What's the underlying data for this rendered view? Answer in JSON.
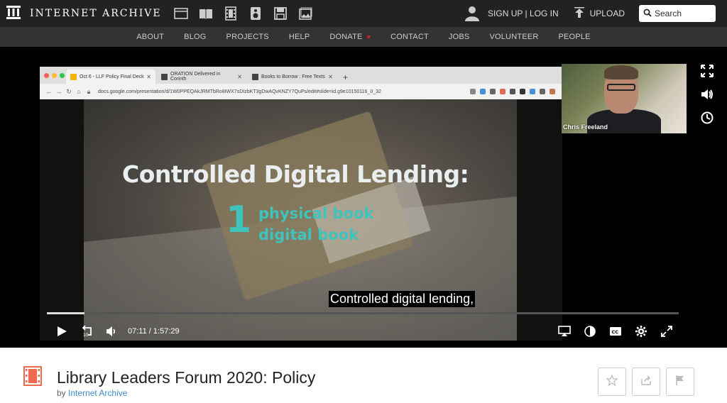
{
  "header": {
    "logo_text": "INTERNET ARCHIVE",
    "media_icons": [
      "web-icon",
      "texts-icon",
      "video-icon",
      "audio-icon",
      "software-icon",
      "images-icon"
    ],
    "signup_text": "SIGN UP | LOG IN",
    "upload_text": "UPLOAD",
    "search_placeholder": "Search"
  },
  "nav": {
    "items": [
      "ABOUT",
      "BLOG",
      "PROJECTS",
      "HELP",
      "DONATE",
      "CONTACT",
      "JOBS",
      "VOLUNTEER",
      "PEOPLE"
    ]
  },
  "browser": {
    "tabs": [
      {
        "label": "Oct 6 - LLF Policy Final Deck"
      },
      {
        "label": "ORATION Delivered in Corinth"
      },
      {
        "label": "Books to Borrow : Free Texts"
      }
    ],
    "url": "docs.google.com/presentation/d/1W0PPEQAkJRMTbRo8IWX7sDIzbKT3gDwAQvKNZY7QuPs/edit#slide=id.g9e10150116_0_32"
  },
  "slide": {
    "title": "Controlled Digital Lending:",
    "number": "1",
    "line1": "physical book",
    "line2": "digital book"
  },
  "caption": "Controlled digital lending,",
  "webcam": {
    "name": "Chris Freeland"
  },
  "player": {
    "current_time": "07:11",
    "separator": "/",
    "duration": "1:57:29",
    "progress_fraction": 0.06
  },
  "item": {
    "title": "Library Leaders Forum 2020: Policy",
    "by_prefix": "by",
    "author": "Internet Archive"
  },
  "colors": {
    "topbar": "#222222",
    "navbar": "#333333",
    "slide_accent": "#3fc3bd",
    "link": "#428bca",
    "donate_heart": "#e02424"
  }
}
